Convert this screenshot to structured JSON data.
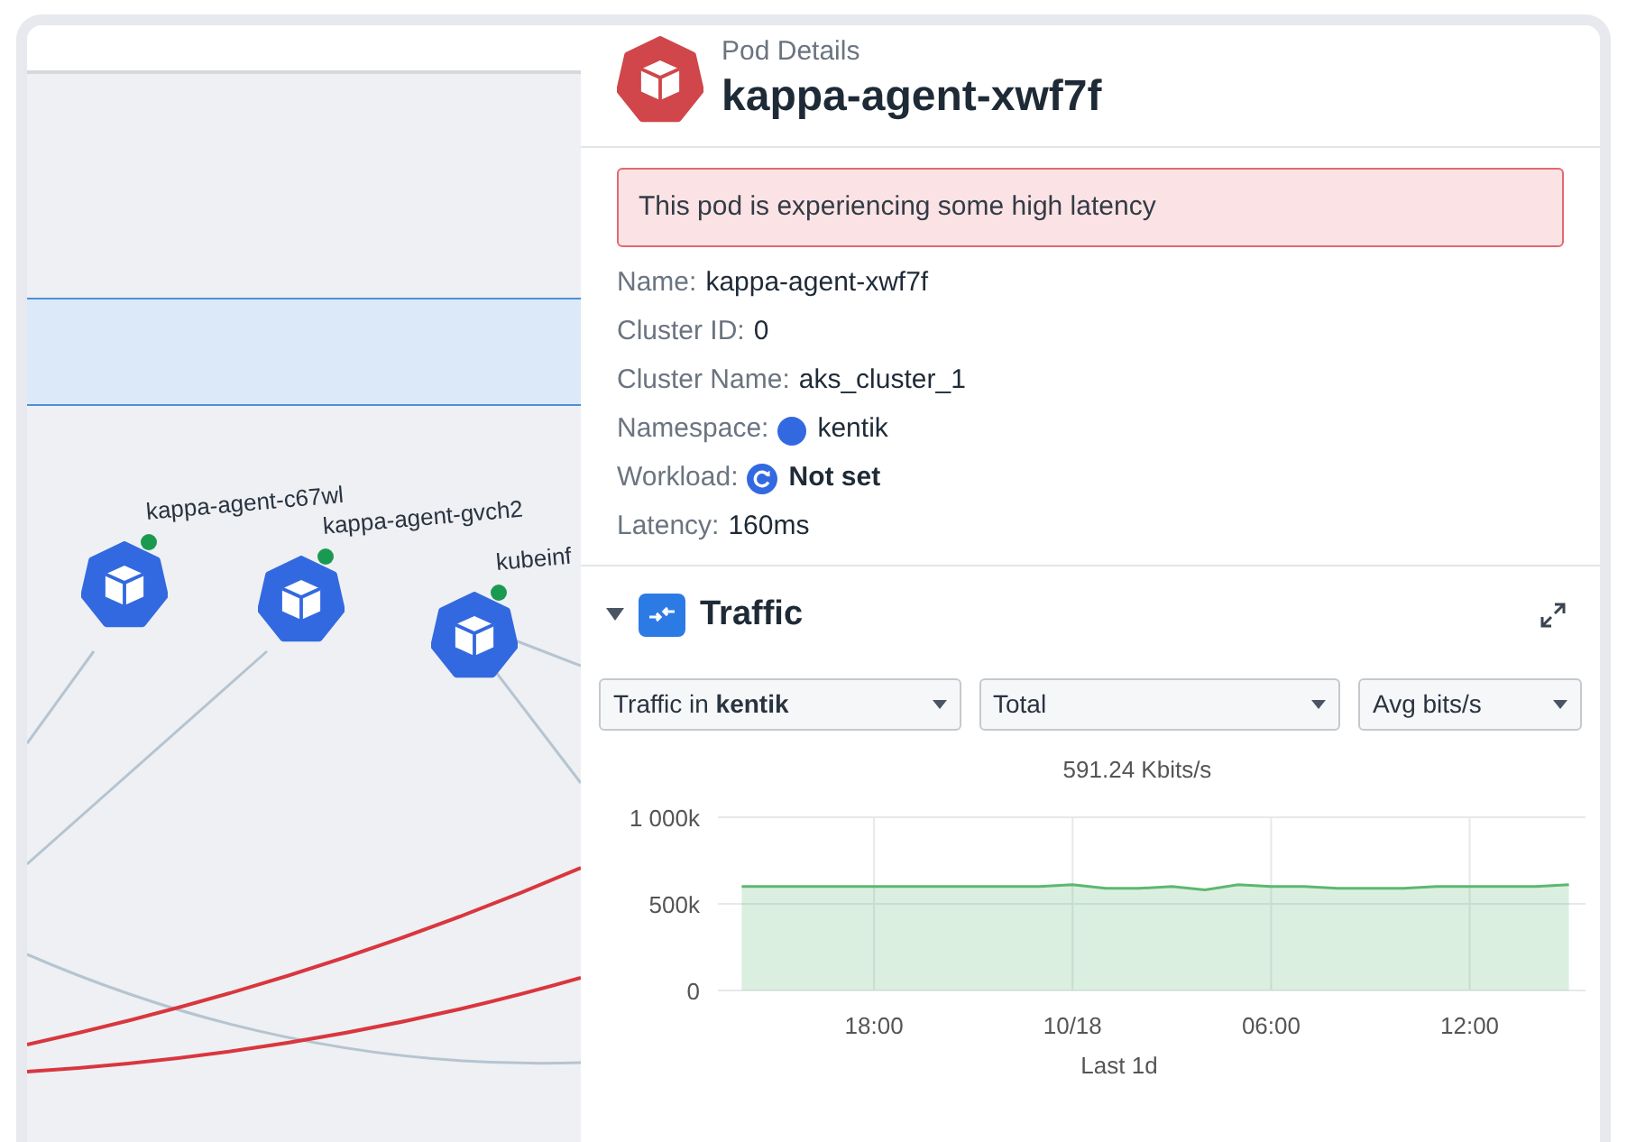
{
  "topology": {
    "nodes": [
      {
        "label": "kappa-agent-c67wl"
      },
      {
        "label": "kappa-agent-gvch2"
      },
      {
        "label": "kubeinf"
      }
    ]
  },
  "panel": {
    "subtitle": "Pod Details",
    "title": "kappa-agent-xwf7f",
    "alert": "This pod is experiencing some high latency",
    "details": [
      {
        "kind": "text",
        "label": "Name:",
        "value": "kappa-agent-xwf7f"
      },
      {
        "kind": "text",
        "label": "Cluster ID:",
        "value": "0"
      },
      {
        "kind": "text",
        "label": "Cluster Name:",
        "value": "aks_cluster_1"
      },
      {
        "kind": "namespace",
        "label": "Namespace:",
        "value": "kentik"
      },
      {
        "kind": "workload",
        "label": "Workload:",
        "value": "Not set"
      },
      {
        "kind": "text",
        "label": "Latency:",
        "value": "160ms"
      }
    ],
    "traffic": {
      "title": "Traffic",
      "expanded": true,
      "selects": [
        {
          "value": "Traffic in **kentik**"
        },
        {
          "value": "Total"
        },
        {
          "value": "Avg bits/s"
        }
      ],
      "chart_data": {
        "type": "area",
        "title": "591.24 Kbits/s",
        "xlabel": "Last 1d",
        "categories": [
          null,
          null,
          null,
          null,
          "18:00",
          null,
          null,
          null,
          null,
          null,
          "10/18",
          null,
          null,
          null,
          null,
          null,
          "06:00",
          null,
          null,
          null,
          null,
          null,
          "12:00",
          null,
          null,
          null
        ],
        "series": [
          {
            "color": "#5cb870",
            "values": [
              600000,
              600000,
              600000,
              600000,
              600000,
              600000,
              600000,
              600000,
              600000,
              600000,
              610000,
              590000,
              590000,
              600000,
              580000,
              610000,
              600000,
              600000,
              590000,
              590000,
              590000,
              600000,
              600000,
              600000,
              600000,
              610000
            ]
          }
        ],
        "ylim": [
          0,
          1000000
        ],
        "grid": true,
        "yticks": [
          {
            "value": 0,
            "label": "0"
          },
          {
            "value": 500000,
            "label": "500k"
          },
          {
            "value": 1000000,
            "label": "1 000k"
          }
        ]
      }
    }
  }
}
